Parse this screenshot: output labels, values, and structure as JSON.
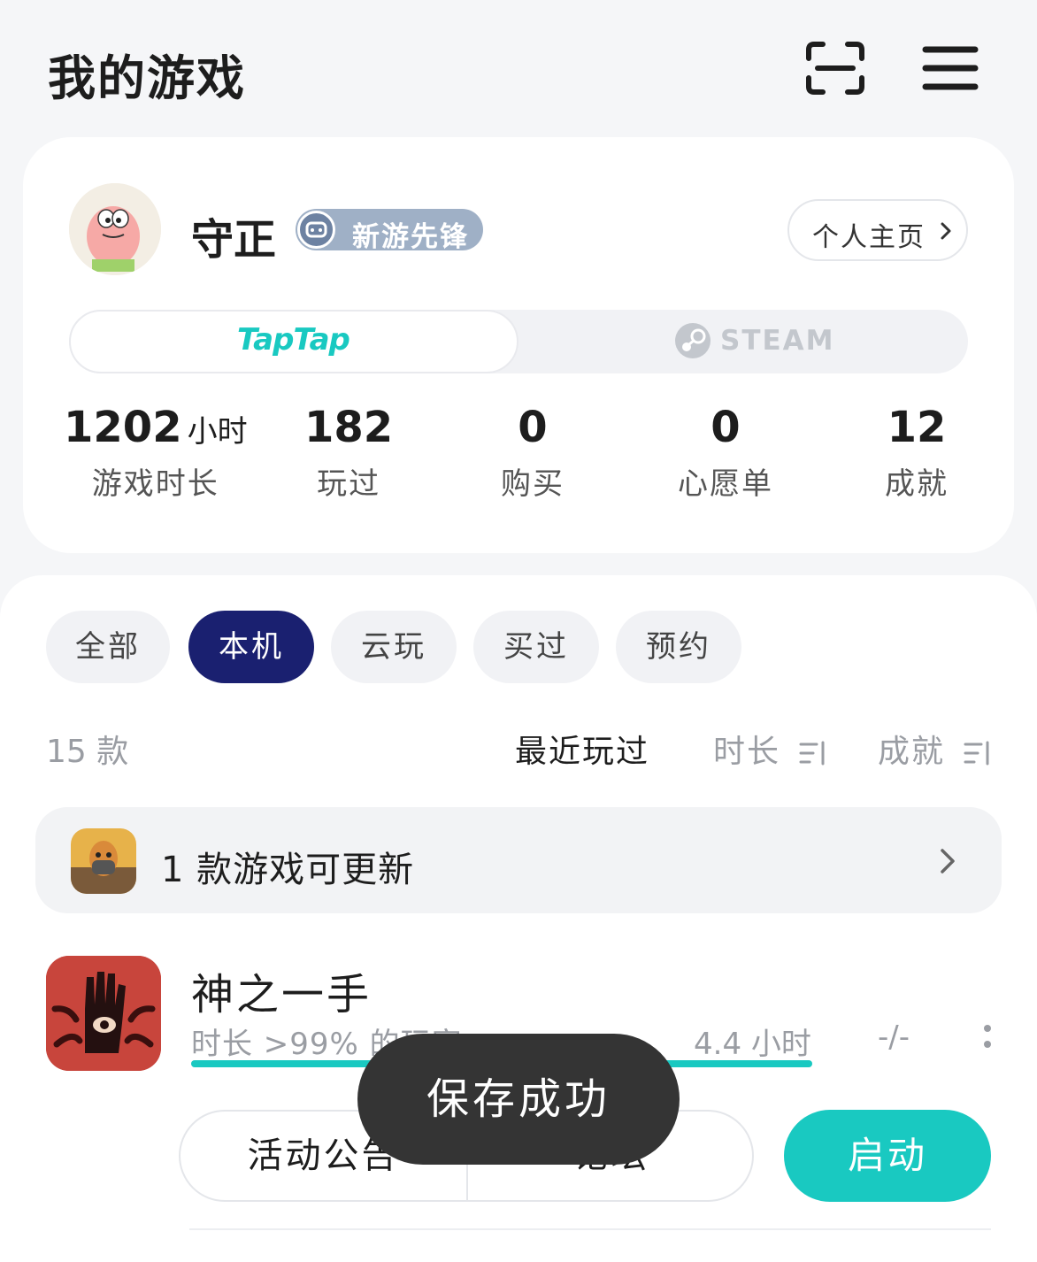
{
  "header": {
    "title": "我的游戏",
    "scan_icon": "scan-icon",
    "menu_icon": "menu-icon"
  },
  "profile": {
    "username": "守正",
    "badge": "新游先锋",
    "homepage_label": "个人主页",
    "platform_tabs": {
      "taptap": "TapTap",
      "steam": "STEAM",
      "active": "taptap"
    },
    "stats": [
      {
        "value": "1202",
        "unit": "小时",
        "label": "游戏时长"
      },
      {
        "value": "182",
        "unit": "",
        "label": "玩过"
      },
      {
        "value": "0",
        "unit": "",
        "label": "购买"
      },
      {
        "value": "0",
        "unit": "",
        "label": "心愿单"
      },
      {
        "value": "12",
        "unit": "",
        "label": "成就"
      }
    ]
  },
  "filters": {
    "items": [
      "全部",
      "本机",
      "云玩",
      "买过",
      "预约"
    ],
    "active": "本机"
  },
  "list": {
    "count": "15 款",
    "sort": {
      "recent": "最近玩过",
      "duration": "时长",
      "achievement": "成就",
      "active": "recent"
    }
  },
  "update_bar": {
    "label": "1 款游戏可更新"
  },
  "game": {
    "name": "神之一手",
    "percentile_text": "时长 >99% 的玩家",
    "hours": "4.4 小时",
    "achievements": "-/-",
    "progress": 1.0,
    "actions": {
      "announcement": "活动公告",
      "forum": "论坛",
      "launch": "启动"
    }
  },
  "toast": {
    "message": "保存成功"
  },
  "colors": {
    "accent": "#19c9c1",
    "active_chip": "#1a2070",
    "background": "#f5f6f8",
    "toast": "#343434"
  }
}
